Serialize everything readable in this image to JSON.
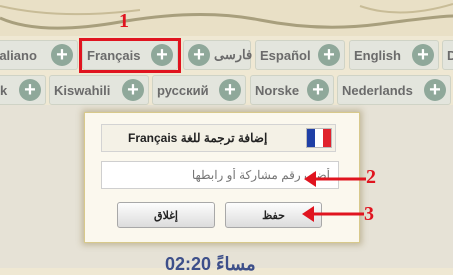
{
  "languages_row1": [
    {
      "label": "taliano"
    },
    {
      "label": "Français"
    },
    {
      "label": "فارسی"
    },
    {
      "label": "Español"
    },
    {
      "label": "English"
    },
    {
      "label": "D"
    }
  ],
  "languages_row2": [
    {
      "label": "rk"
    },
    {
      "label": "Kiswahili"
    },
    {
      "label": "русский"
    },
    {
      "label": "Norske"
    },
    {
      "label": "Nederlands"
    },
    {
      "label": ""
    }
  ],
  "annotations": {
    "n1": "1",
    "n2": "2",
    "n3": "3"
  },
  "dialog": {
    "title": "إضافة ترجمة للغة Français",
    "input_placeholder": "أضف رقم مشاركة أو رابطها",
    "close_label": "إغلاق",
    "save_label": "حفظ"
  },
  "background_time": "02:20 مساءً",
  "colors": {
    "accent_red": "#e0141f",
    "plus_green": "#8fa89a",
    "flag_blue": "#1f3fa6",
    "flag_red": "#e0232e"
  }
}
